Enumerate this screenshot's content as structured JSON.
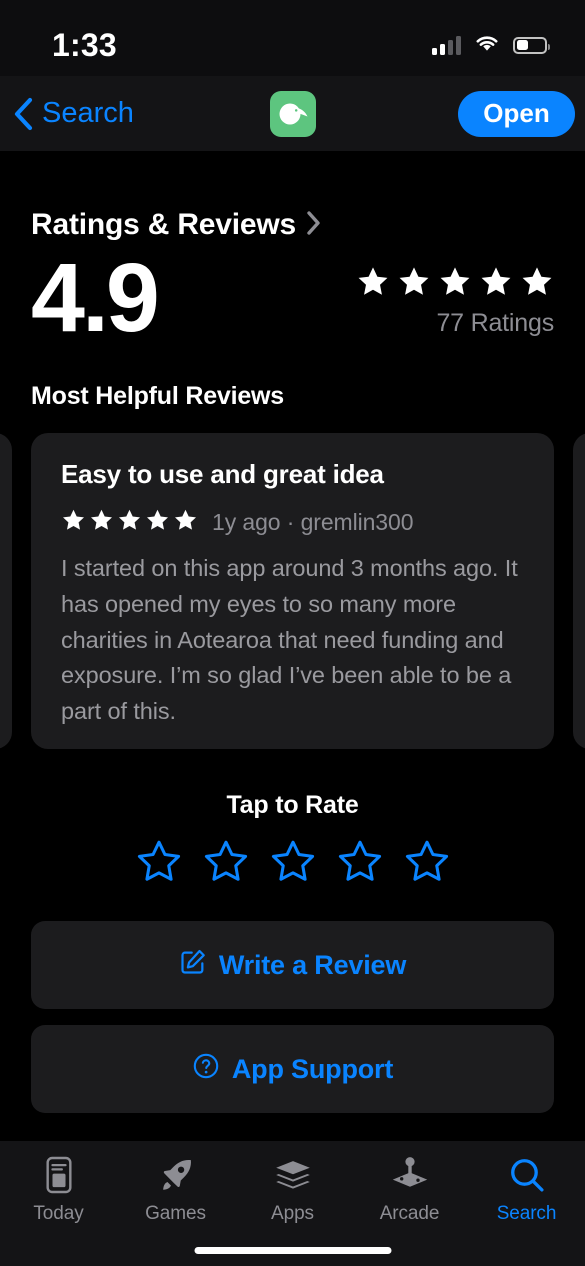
{
  "status_bar": {
    "time": "1:33",
    "cellular_icon": "cellular-bars-icon",
    "wifi_icon": "wifi-icon",
    "battery_icon": "battery-icon"
  },
  "nav_bar": {
    "back_label": "Search",
    "back_icon": "chevron-left-icon",
    "app_icon": "kiwi-app-icon",
    "open_label": "Open",
    "accent_color": "#0a84ff",
    "app_icon_color": "#5dc57f"
  },
  "ratings_section": {
    "title": "Ratings & Reviews",
    "disclosure_icon": "chevron-right-icon",
    "score": "4.9",
    "stars_filled": 5,
    "ratings_count_label": "77 Ratings"
  },
  "reviews": {
    "heading": "Most Helpful Reviews",
    "cards": [
      {
        "title": "Easy to use and great idea",
        "stars": 5,
        "meta": "1y ago · gremlin300",
        "body": "I started on this app around 3 months ago. It has opened my eyes to so many more charities in Aotearoa that need funding and exposure. I’m so glad I’ve been able to be a part of this."
      }
    ]
  },
  "tap_to_rate": {
    "label": "Tap to Rate",
    "star_count": 5,
    "stars_selected": 0,
    "star_color": "#0a84ff"
  },
  "actions": {
    "write_review_label": "Write a Review",
    "write_review_icon": "square-and-pencil-icon",
    "app_support_label": "App Support",
    "app_support_icon": "question-mark-circle-icon"
  },
  "tab_bar": {
    "items": [
      {
        "label": "Today",
        "icon": "today-doc-icon",
        "active": false
      },
      {
        "label": "Games",
        "icon": "rocket-icon",
        "active": false
      },
      {
        "label": "Apps",
        "icon": "stacked-layers-icon",
        "active": false
      },
      {
        "label": "Arcade",
        "icon": "joystick-icon",
        "active": false
      },
      {
        "label": "Search",
        "icon": "magnifier-icon",
        "active": true
      }
    ],
    "active_color": "#0a84ff",
    "inactive_color": "#8d8d93"
  }
}
